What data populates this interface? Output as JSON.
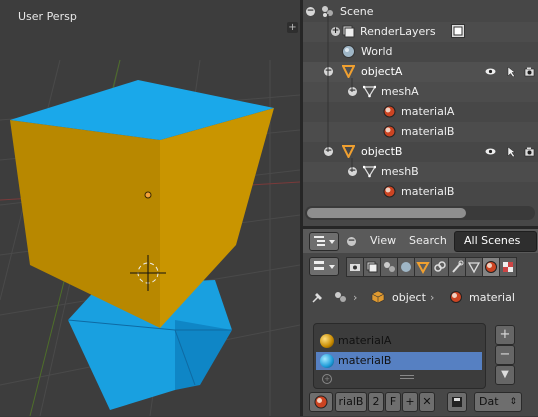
{
  "viewport": {
    "label": "User Persp",
    "plus": "+",
    "colors": {
      "top": "#1aa7e8",
      "front": "#b98900",
      "right": "#d49b00",
      "grid": "#474747"
    }
  },
  "outliner": {
    "rows": [
      {
        "label": "Scene",
        "icon": "scene-icon"
      },
      {
        "label": "RenderLayers",
        "icon": "render-layers-icon"
      },
      {
        "label": "World",
        "icon": "world-icon"
      },
      {
        "label": "objectA",
        "icon": "object-icon"
      },
      {
        "label": "meshA",
        "icon": "mesh-icon"
      },
      {
        "label": "materialA",
        "icon": "material-icon"
      },
      {
        "label": "materialB",
        "icon": "material-icon"
      },
      {
        "label": "objectB",
        "icon": "object-icon"
      },
      {
        "label": "meshB",
        "icon": "mesh-icon"
      },
      {
        "label": "materialB",
        "icon": "material-icon"
      }
    ]
  },
  "outliner_header": {
    "view": "View",
    "search": "Search",
    "scenes": "All Scenes"
  },
  "properties": {
    "breadcrumb": {
      "object": "object",
      "material": "material"
    },
    "materials": [
      {
        "label": "materialA",
        "color": "#e0a010"
      },
      {
        "label": "materialB",
        "color": "#1c9ad8"
      }
    ],
    "plus_btn": "+",
    "minus_btn": "−",
    "bottom": {
      "name": "rialB",
      "users": "2",
      "fake": "F",
      "data": "Dat"
    }
  }
}
